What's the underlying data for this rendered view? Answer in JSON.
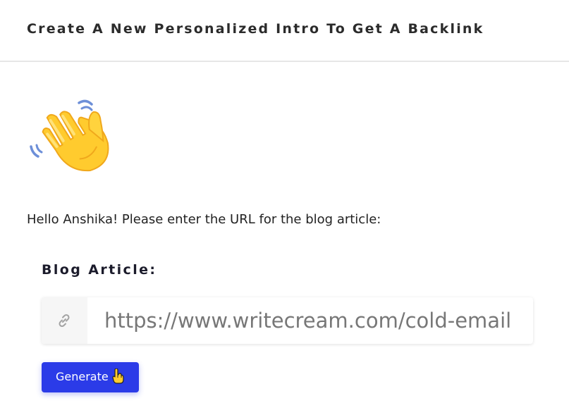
{
  "header": {
    "title": "Create A New Personalized Intro To Get A Backlink"
  },
  "greeting": {
    "icon": "waving-hand-icon",
    "text": "Hello Anshika! Please enter the URL for the blog article:"
  },
  "form": {
    "field_label": "Blog Article:",
    "field_icon": "link-icon",
    "url_value": "https://www.writecream.com/cold-email",
    "generate_label": "Generate",
    "generate_icon": "pointing-hand-icon"
  },
  "colors": {
    "accent": "#2b3be8",
    "header_border": "#e6e6e6",
    "hand": "#ffcb2e"
  }
}
